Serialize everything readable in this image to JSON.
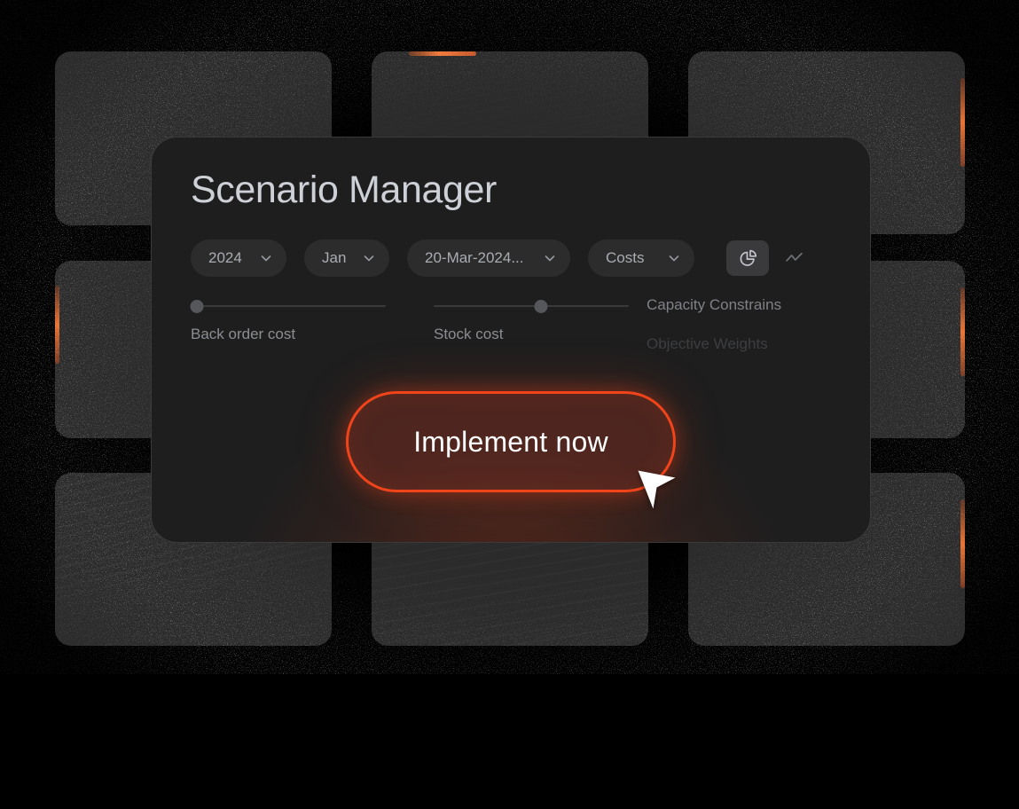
{
  "modal": {
    "title": "Scenario Manager",
    "filters": [
      {
        "name": "year",
        "value": "2024",
        "icon": "chevron-down-icon"
      },
      {
        "name": "month",
        "value": "Jan",
        "icon": "chevron-down-icon"
      },
      {
        "name": "date",
        "value": "20-Mar-2024...",
        "icon": "chevron-down-icon"
      },
      {
        "name": "metric",
        "value": "Costs",
        "icon": "chevron-down-icon"
      }
    ],
    "view_toggle": [
      {
        "name": "pie-chart-icon",
        "active": true
      },
      {
        "name": "line-chart-icon",
        "active": false
      }
    ],
    "sliders": [
      {
        "label": "Back order cost",
        "value": 0
      },
      {
        "label": "Stock cost",
        "value": 55
      }
    ],
    "side_labels": {
      "capacity": "Capacity Constrains",
      "objective": "Objective Weights"
    },
    "cta_label": "Implement now"
  },
  "colors": {
    "accent": "#f2441a",
    "accent_warm": "#e8702f",
    "modal_bg": "#1e1e1e",
    "card_bg": "#2b2b2b",
    "page_bg": "#000000",
    "title_text": "#cdd0d6",
    "muted_text": "#8b8e93"
  },
  "cursor": {
    "name": "mouse-pointer"
  }
}
